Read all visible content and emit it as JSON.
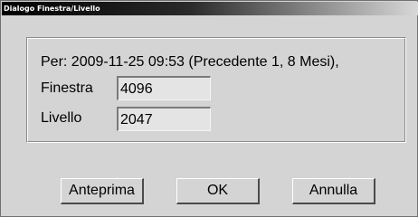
{
  "window": {
    "title": "Dialogo Finestra/Livello"
  },
  "info": {
    "text": "Per: 2009-11-25 09:53 (Precedente 1, 8 Mesi),"
  },
  "fields": {
    "finestra": {
      "label": "Finestra",
      "value": "4096"
    },
    "livello": {
      "label": "Livello",
      "value": "2047"
    }
  },
  "buttons": {
    "preview": "Anteprima",
    "ok": "OK",
    "cancel": "Annulla"
  },
  "colors": {
    "dialog_background": "#d4d4d4",
    "titlebar_start": "#000000",
    "titlebar_end": "#d8d8d8",
    "field_background": "#e4e4e4"
  }
}
